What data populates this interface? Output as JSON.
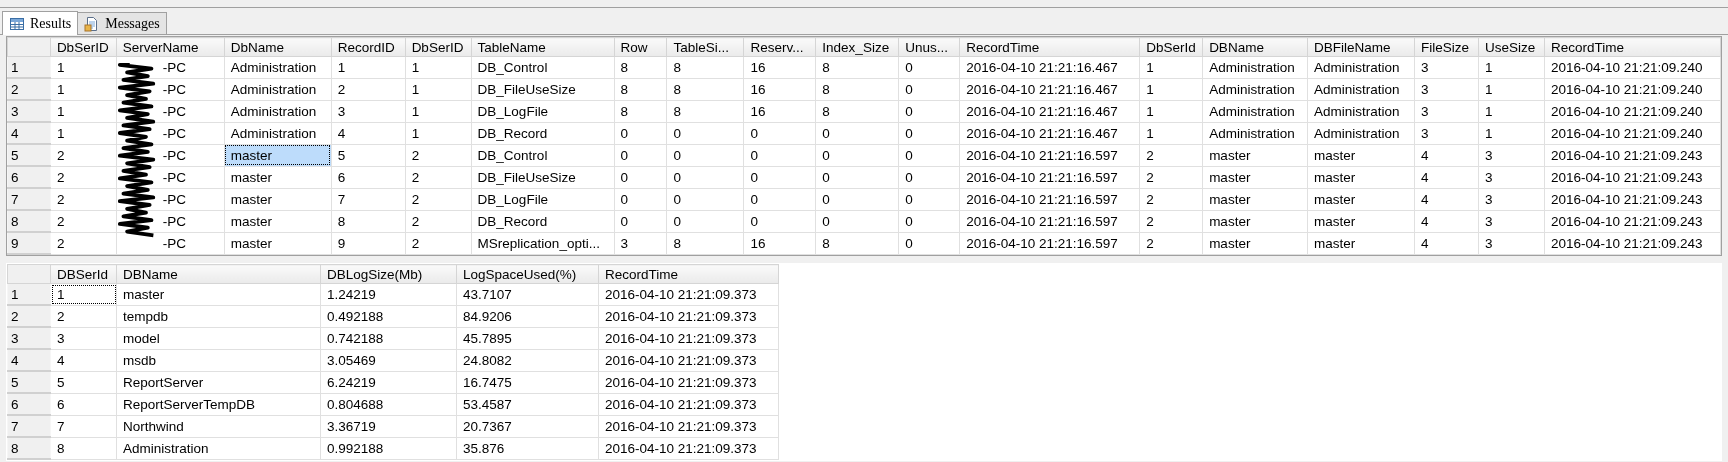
{
  "tabs": [
    {
      "label": "Results",
      "selected": true
    },
    {
      "label": "Messages",
      "selected": false
    }
  ],
  "grids": [
    {
      "redacted_column": true,
      "columns": [
        "DbSerID",
        "ServerName",
        "DbName",
        "RecordID",
        "DbSerID",
        "TableName",
        "Row",
        "TableSi...",
        "Reserv...",
        "Index_Size",
        "Unus...",
        "RecordTime",
        "DbSerId",
        "DBName",
        "DBFileName",
        "FileSize",
        "UseSize",
        "RecordTime"
      ],
      "rows": [
        {
          "number": "1",
          "cells": [
            {
              "text": "1",
              "selected": false
            },
            {
              "text": "-PC",
              "selected": false
            },
            {
              "text": "Administration",
              "selected": false
            },
            {
              "text": "1",
              "selected": false
            },
            {
              "text": "1",
              "selected": false
            },
            {
              "text": "DB_Control",
              "selected": false
            },
            {
              "text": "8",
              "selected": false
            },
            {
              "text": "8",
              "selected": false
            },
            {
              "text": "16",
              "selected": false
            },
            {
              "text": "8",
              "selected": false
            },
            {
              "text": "0",
              "selected": false
            },
            {
              "text": "2016-04-10 21:21:16.467",
              "selected": false
            },
            {
              "text": "1",
              "selected": false
            },
            {
              "text": "Administration",
              "selected": false
            },
            {
              "text": "Administration",
              "selected": false
            },
            {
              "text": "3",
              "selected": false
            },
            {
              "text": "1",
              "selected": false
            },
            {
              "text": "2016-04-10 21:21:09.240",
              "selected": false
            }
          ]
        },
        {
          "number": "2",
          "cells": [
            {
              "text": "1",
              "selected": false
            },
            {
              "text": "-PC",
              "selected": false
            },
            {
              "text": "Administration",
              "selected": false
            },
            {
              "text": "2",
              "selected": false
            },
            {
              "text": "1",
              "selected": false
            },
            {
              "text": "DB_FileUseSize",
              "selected": false
            },
            {
              "text": "8",
              "selected": false
            },
            {
              "text": "8",
              "selected": false
            },
            {
              "text": "16",
              "selected": false
            },
            {
              "text": "8",
              "selected": false
            },
            {
              "text": "0",
              "selected": false
            },
            {
              "text": "2016-04-10 21:21:16.467",
              "selected": false
            },
            {
              "text": "1",
              "selected": false
            },
            {
              "text": "Administration",
              "selected": false
            },
            {
              "text": "Administration",
              "selected": false
            },
            {
              "text": "3",
              "selected": false
            },
            {
              "text": "1",
              "selected": false
            },
            {
              "text": "2016-04-10 21:21:09.240",
              "selected": false
            }
          ]
        },
        {
          "number": "3",
          "cells": [
            {
              "text": "1",
              "selected": false
            },
            {
              "text": "-PC",
              "selected": false
            },
            {
              "text": "Administration",
              "selected": false
            },
            {
              "text": "3",
              "selected": false
            },
            {
              "text": "1",
              "selected": false
            },
            {
              "text": "DB_LogFile",
              "selected": false
            },
            {
              "text": "8",
              "selected": false
            },
            {
              "text": "8",
              "selected": false
            },
            {
              "text": "16",
              "selected": false
            },
            {
              "text": "8",
              "selected": false
            },
            {
              "text": "0",
              "selected": false
            },
            {
              "text": "2016-04-10 21:21:16.467",
              "selected": false
            },
            {
              "text": "1",
              "selected": false
            },
            {
              "text": "Administration",
              "selected": false
            },
            {
              "text": "Administration",
              "selected": false
            },
            {
              "text": "3",
              "selected": false
            },
            {
              "text": "1",
              "selected": false
            },
            {
              "text": "2016-04-10 21:21:09.240",
              "selected": false
            }
          ]
        },
        {
          "number": "4",
          "cells": [
            {
              "text": "1",
              "selected": false
            },
            {
              "text": "-PC",
              "selected": false
            },
            {
              "text": "Administration",
              "selected": false
            },
            {
              "text": "4",
              "selected": false
            },
            {
              "text": "1",
              "selected": false
            },
            {
              "text": "DB_Record",
              "selected": false
            },
            {
              "text": "0",
              "selected": false
            },
            {
              "text": "0",
              "selected": false
            },
            {
              "text": "0",
              "selected": false
            },
            {
              "text": "0",
              "selected": false
            },
            {
              "text": "0",
              "selected": false
            },
            {
              "text": "2016-04-10 21:21:16.467",
              "selected": false
            },
            {
              "text": "1",
              "selected": false
            },
            {
              "text": "Administration",
              "selected": false
            },
            {
              "text": "Administration",
              "selected": false
            },
            {
              "text": "3",
              "selected": false
            },
            {
              "text": "1",
              "selected": false
            },
            {
              "text": "2016-04-10 21:21:09.240",
              "selected": false
            }
          ]
        },
        {
          "number": "5",
          "cells": [
            {
              "text": "2",
              "selected": false
            },
            {
              "text": "-PC",
              "selected": false
            },
            {
              "text": "master",
              "selected": true
            },
            {
              "text": "5",
              "selected": false
            },
            {
              "text": "2",
              "selected": false
            },
            {
              "text": "DB_Control",
              "selected": false
            },
            {
              "text": "0",
              "selected": false
            },
            {
              "text": "0",
              "selected": false
            },
            {
              "text": "0",
              "selected": false
            },
            {
              "text": "0",
              "selected": false
            },
            {
              "text": "0",
              "selected": false
            },
            {
              "text": "2016-04-10 21:21:16.597",
              "selected": false
            },
            {
              "text": "2",
              "selected": false
            },
            {
              "text": "master",
              "selected": false
            },
            {
              "text": "master",
              "selected": false
            },
            {
              "text": "4",
              "selected": false
            },
            {
              "text": "3",
              "selected": false
            },
            {
              "text": "2016-04-10 21:21:09.243",
              "selected": false
            }
          ]
        },
        {
          "number": "6",
          "cells": [
            {
              "text": "2",
              "selected": false
            },
            {
              "text": "-PC",
              "selected": false
            },
            {
              "text": "master",
              "selected": false
            },
            {
              "text": "6",
              "selected": false
            },
            {
              "text": "2",
              "selected": false
            },
            {
              "text": "DB_FileUseSize",
              "selected": false
            },
            {
              "text": "0",
              "selected": false
            },
            {
              "text": "0",
              "selected": false
            },
            {
              "text": "0",
              "selected": false
            },
            {
              "text": "0",
              "selected": false
            },
            {
              "text": "0",
              "selected": false
            },
            {
              "text": "2016-04-10 21:21:16.597",
              "selected": false
            },
            {
              "text": "2",
              "selected": false
            },
            {
              "text": "master",
              "selected": false
            },
            {
              "text": "master",
              "selected": false
            },
            {
              "text": "4",
              "selected": false
            },
            {
              "text": "3",
              "selected": false
            },
            {
              "text": "2016-04-10 21:21:09.243",
              "selected": false
            }
          ]
        },
        {
          "number": "7",
          "cells": [
            {
              "text": "2",
              "selected": false
            },
            {
              "text": "-PC",
              "selected": false
            },
            {
              "text": "master",
              "selected": false
            },
            {
              "text": "7",
              "selected": false
            },
            {
              "text": "2",
              "selected": false
            },
            {
              "text": "DB_LogFile",
              "selected": false
            },
            {
              "text": "0",
              "selected": false
            },
            {
              "text": "0",
              "selected": false
            },
            {
              "text": "0",
              "selected": false
            },
            {
              "text": "0",
              "selected": false
            },
            {
              "text": "0",
              "selected": false
            },
            {
              "text": "2016-04-10 21:21:16.597",
              "selected": false
            },
            {
              "text": "2",
              "selected": false
            },
            {
              "text": "master",
              "selected": false
            },
            {
              "text": "master",
              "selected": false
            },
            {
              "text": "4",
              "selected": false
            },
            {
              "text": "3",
              "selected": false
            },
            {
              "text": "2016-04-10 21:21:09.243",
              "selected": false
            }
          ]
        },
        {
          "number": "8",
          "cells": [
            {
              "text": "2",
              "selected": false
            },
            {
              "text": "-PC",
              "selected": false
            },
            {
              "text": "master",
              "selected": false
            },
            {
              "text": "8",
              "selected": false
            },
            {
              "text": "2",
              "selected": false
            },
            {
              "text": "DB_Record",
              "selected": false
            },
            {
              "text": "0",
              "selected": false
            },
            {
              "text": "0",
              "selected": false
            },
            {
              "text": "0",
              "selected": false
            },
            {
              "text": "0",
              "selected": false
            },
            {
              "text": "0",
              "selected": false
            },
            {
              "text": "2016-04-10 21:21:16.597",
              "selected": false
            },
            {
              "text": "2",
              "selected": false
            },
            {
              "text": "master",
              "selected": false
            },
            {
              "text": "master",
              "selected": false
            },
            {
              "text": "4",
              "selected": false
            },
            {
              "text": "3",
              "selected": false
            },
            {
              "text": "2016-04-10 21:21:09.243",
              "selected": false
            }
          ]
        },
        {
          "number": "9",
          "cells": [
            {
              "text": "2",
              "selected": false
            },
            {
              "text": "-PC",
              "selected": false
            },
            {
              "text": "master",
              "selected": false
            },
            {
              "text": "9",
              "selected": false
            },
            {
              "text": "2",
              "selected": false
            },
            {
              "text": "MSreplication_opti...",
              "selected": false
            },
            {
              "text": "3",
              "selected": false
            },
            {
              "text": "8",
              "selected": false
            },
            {
              "text": "16",
              "selected": false
            },
            {
              "text": "8",
              "selected": false
            },
            {
              "text": "0",
              "selected": false
            },
            {
              "text": "2016-04-10 21:21:16.597",
              "selected": false
            },
            {
              "text": "2",
              "selected": false
            },
            {
              "text": "master",
              "selected": false
            },
            {
              "text": "master",
              "selected": false
            },
            {
              "text": "4",
              "selected": false
            },
            {
              "text": "3",
              "selected": false
            },
            {
              "text": "2016-04-10 21:21:09.243",
              "selected": false
            }
          ]
        }
      ]
    },
    {
      "redacted_column": false,
      "columns": [
        "DBSerId",
        "DBName",
        "DBLogSize(Mb)",
        "LogSpaceUsed(%)",
        "RecordTime"
      ],
      "rows": [
        {
          "number": "1",
          "cells": [
            {
              "text": "1",
              "focused": true
            },
            {
              "text": "master",
              "focused": false
            },
            {
              "text": "1.24219",
              "focused": false
            },
            {
              "text": "43.7107",
              "focused": false
            },
            {
              "text": "2016-04-10 21:21:09.373",
              "focused": false
            }
          ]
        },
        {
          "number": "2",
          "cells": [
            {
              "text": "2",
              "focused": false
            },
            {
              "text": "tempdb",
              "focused": false
            },
            {
              "text": "0.492188",
              "focused": false
            },
            {
              "text": "84.9206",
              "focused": false
            },
            {
              "text": "2016-04-10 21:21:09.373",
              "focused": false
            }
          ]
        },
        {
          "number": "3",
          "cells": [
            {
              "text": "3",
              "focused": false
            },
            {
              "text": "model",
              "focused": false
            },
            {
              "text": "0.742188",
              "focused": false
            },
            {
              "text": "45.7895",
              "focused": false
            },
            {
              "text": "2016-04-10 21:21:09.373",
              "focused": false
            }
          ]
        },
        {
          "number": "4",
          "cells": [
            {
              "text": "4",
              "focused": false
            },
            {
              "text": "msdb",
              "focused": false
            },
            {
              "text": "3.05469",
              "focused": false
            },
            {
              "text": "24.8082",
              "focused": false
            },
            {
              "text": "2016-04-10 21:21:09.373",
              "focused": false
            }
          ]
        },
        {
          "number": "5",
          "cells": [
            {
              "text": "5",
              "focused": false
            },
            {
              "text": "ReportServer",
              "focused": false
            },
            {
              "text": "6.24219",
              "focused": false
            },
            {
              "text": "16.7475",
              "focused": false
            },
            {
              "text": "2016-04-10 21:21:09.373",
              "focused": false
            }
          ]
        },
        {
          "number": "6",
          "cells": [
            {
              "text": "6",
              "focused": false
            },
            {
              "text": "ReportServerTempDB",
              "focused": false
            },
            {
              "text": "0.804688",
              "focused": false
            },
            {
              "text": "53.4587",
              "focused": false
            },
            {
              "text": "2016-04-10 21:21:09.373",
              "focused": false
            }
          ]
        },
        {
          "number": "7",
          "cells": [
            {
              "text": "7",
              "focused": false
            },
            {
              "text": "Northwind",
              "focused": false
            },
            {
              "text": "3.36719",
              "focused": false
            },
            {
              "text": "20.7367",
              "focused": false
            },
            {
              "text": "2016-04-10 21:21:09.373",
              "focused": false
            }
          ]
        },
        {
          "number": "8",
          "cells": [
            {
              "text": "8",
              "focused": false
            },
            {
              "text": "Administration",
              "focused": false
            },
            {
              "text": "0.992188",
              "focused": false
            },
            {
              "text": "35.876",
              "focused": false
            },
            {
              "text": "2016-04-10 21:21:09.373",
              "focused": false
            }
          ]
        }
      ]
    }
  ]
}
